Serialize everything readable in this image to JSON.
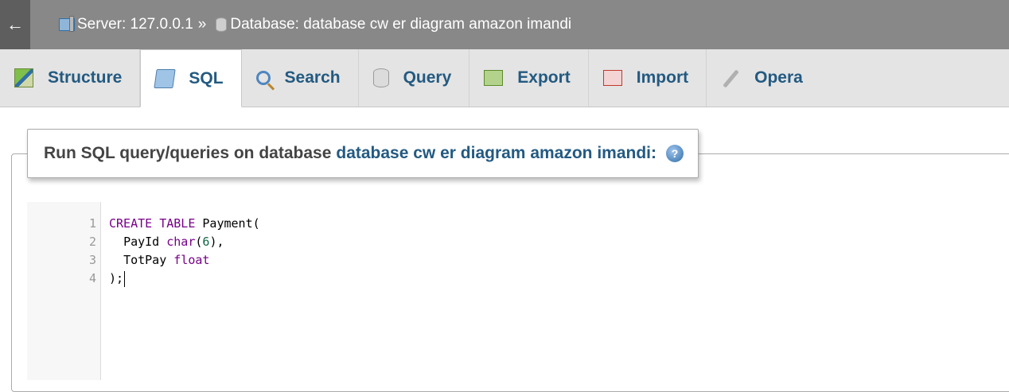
{
  "breadcrumb": {
    "back_glyph": "←",
    "server_label": "Server: 127.0.0.1",
    "separator": "»",
    "database_label": "Database: database cw er diagram amazon imandi"
  },
  "tabs": [
    {
      "label": "Structure",
      "icon": "structure-icon",
      "active": false
    },
    {
      "label": "SQL",
      "icon": "sql-icon",
      "active": true
    },
    {
      "label": "Search",
      "icon": "search-icon",
      "active": false
    },
    {
      "label": "Query",
      "icon": "query-icon",
      "active": false
    },
    {
      "label": "Export",
      "icon": "export-icon",
      "active": false
    },
    {
      "label": "Import",
      "icon": "import-icon",
      "active": false
    },
    {
      "label": "Opera",
      "icon": "operations-icon",
      "active": false
    }
  ],
  "panel": {
    "heading_prefix": "Run SQL query/queries on database",
    "database_name": "database cw er diagram amazon imandi:",
    "help_icon": "help-icon"
  },
  "editor": {
    "line_numbers": [
      "1",
      "2",
      "3",
      "4"
    ],
    "lines": {
      "l1_kw1": "CREATE",
      "l1_kw2": "TABLE",
      "l1_name": "Payment",
      "l1_paren": "(",
      "l2_name": "PayId",
      "l2_type": "char",
      "l2_open": "(",
      "l2_num": "6",
      "l2_close": "),",
      "l3_name": "TotPay",
      "l3_type": "float",
      "l4": ");"
    }
  },
  "colors": {
    "topbar": "#888888",
    "tab_text": "#235a81",
    "keyword": "#770088",
    "number": "#116644"
  }
}
